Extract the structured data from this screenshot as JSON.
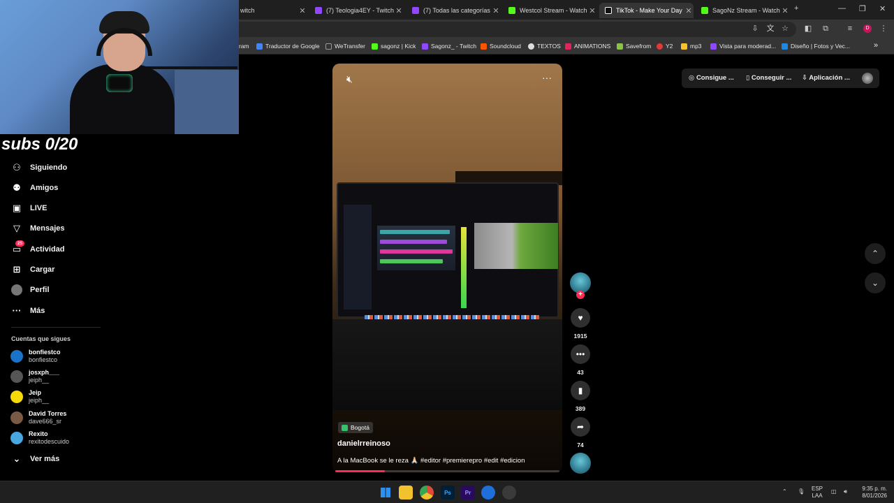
{
  "browser": {
    "tabs": [
      {
        "label": "witch",
        "color": "#9146ff"
      },
      {
        "label": "(7) Teologia4EY - Twitch",
        "color": "#9146ff"
      },
      {
        "label": "(7) Todas las categorías -",
        "color": "#9146ff"
      },
      {
        "label": "Westcol Stream - Watch L",
        "color": "#53fc18"
      },
      {
        "label": "TikTok - Make Your Day",
        "color": "#ffffff",
        "active": true
      },
      {
        "label": "SagoNz Stream - Watch L",
        "color": "#53fc18"
      }
    ],
    "new_tab": "+",
    "profile_letter": "D",
    "bookmarks": [
      {
        "label": "ram",
        "color": "#c13584"
      },
      {
        "label": "Traductor de Google",
        "color": "#4285f4"
      },
      {
        "label": "WeTransfer",
        "color": "#333333"
      },
      {
        "label": "sagonz | Kick",
        "color": "#53fc18"
      },
      {
        "label": "Sagonz_ - Twitch",
        "color": "#9146ff"
      },
      {
        "label": "Soundcloud",
        "color": "#ff5500"
      },
      {
        "label": "TEXTOS",
        "color": "#dddddd"
      },
      {
        "label": "ANIMATIONS",
        "color": "#e0245e"
      },
      {
        "label": "Savefrom",
        "color": "#8bc34a"
      },
      {
        "label": "Y2",
        "color": "#e53935"
      },
      {
        "label": "mp3",
        "color": "#fbc02d"
      },
      {
        "label": "Vista para moderad...",
        "color": "#9146ff"
      },
      {
        "label": "Diseño | Fotos y Vec...",
        "color": "#1e88e5"
      }
    ],
    "bookmarks_more": "»"
  },
  "overlay": {
    "subs_text": "subs 0/20"
  },
  "sidebar": {
    "items": [
      {
        "label": "Siguiendo",
        "icon": "following-icon"
      },
      {
        "label": "Amigos",
        "icon": "friends-icon"
      },
      {
        "label": "LIVE",
        "icon": "live-icon"
      },
      {
        "label": "Mensajes",
        "icon": "messages-icon"
      },
      {
        "label": "Actividad",
        "icon": "activity-icon",
        "badge": "25"
      },
      {
        "label": "Cargar",
        "icon": "upload-icon"
      },
      {
        "label": "Perfil",
        "icon": "profile-icon"
      },
      {
        "label": "Más",
        "icon": "more-icon"
      }
    ],
    "following_header": "Cuentas que sigues",
    "following": [
      {
        "name": "bonfiestco",
        "handle": "bonfiestco",
        "color": "#1a73c8"
      },
      {
        "name": "josxph___",
        "handle": "jeiph__",
        "color": "#555555"
      },
      {
        "name": "Jeip",
        "handle": "jeiph__",
        "color": "#f5d90a"
      },
      {
        "name": "David Torres",
        "handle": "dave666_sr",
        "color": "#7a5a44"
      },
      {
        "name": "Rexito",
        "handle": "rexitodescuido",
        "color": "#48a6e0"
      }
    ],
    "see_more": "Ver más"
  },
  "video": {
    "location": "Bogotá",
    "author": "danielrreinoso",
    "caption": "A la MacBook se le reza 🙏🏻 #editor #premierepro #edit #edicion",
    "progress": 0.22
  },
  "actions": {
    "likes": "1915",
    "comments": "43",
    "saves": "389",
    "shares": "74"
  },
  "header": {
    "get_coins": "Consigue ...",
    "get_app": "Conseguir ...",
    "app": "Aplicación ..."
  },
  "taskbar": {
    "apps": [
      {
        "name": "windows-start",
        "color": "#2d8ff0",
        "label": ""
      },
      {
        "name": "file-explorer",
        "color": "#f2c12e",
        "label": ""
      },
      {
        "name": "chrome",
        "color": "#dd4b39",
        "label": ""
      },
      {
        "name": "photoshop",
        "color": "#001e36",
        "label": "Ps"
      },
      {
        "name": "premiere",
        "color": "#2a0a5e",
        "label": "Pr"
      },
      {
        "name": "editor-app",
        "color": "#1e6fd9",
        "label": ""
      },
      {
        "name": "obs",
        "color": "#3a3a3a",
        "label": ""
      }
    ],
    "lang_top": "ESP",
    "lang_bottom": "LAA",
    "time": "9:35 p. m.",
    "date": "8/01/2026"
  }
}
